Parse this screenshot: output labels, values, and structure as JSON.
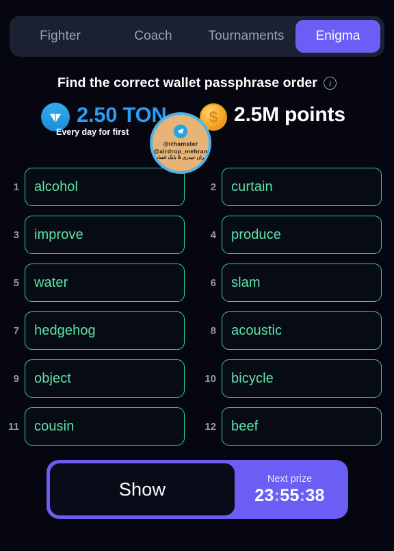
{
  "tabs": [
    {
      "label": "Fighter",
      "active": false
    },
    {
      "label": "Coach",
      "active": false
    },
    {
      "label": "Tournaments",
      "active": false
    },
    {
      "label": "Enigma",
      "active": true
    }
  ],
  "header": {
    "title": "Find the correct wallet passphrase order",
    "info_icon": "info-icon",
    "info_glyph": "i"
  },
  "rewards": {
    "ton": {
      "amount": "2.50 TON",
      "subtitle": "Every day for first",
      "icon": "ton-logo-icon",
      "color": "#2a9df4"
    },
    "points": {
      "amount": "2.5M points",
      "icon": "gold-coin-icon",
      "glyph": "$",
      "color": "#f7a928"
    }
  },
  "watermark": {
    "icon": "telegram-icon",
    "handle_1": "@irhamster",
    "handle_2": "@airdrop_mehran",
    "handle_3": "مهران حیدری & بابک انصاری"
  },
  "grid": {
    "accent_color": "#36d399",
    "text_color": "#5fe3ad",
    "rows": [
      [
        {
          "num": "1",
          "word": "alcohol"
        },
        {
          "num": "2",
          "word": "curtain"
        }
      ],
      [
        {
          "num": "3",
          "word": "improve"
        },
        {
          "num": "4",
          "word": "produce"
        }
      ],
      [
        {
          "num": "5",
          "word": "water"
        },
        {
          "num": "6",
          "word": "slam"
        }
      ],
      [
        {
          "num": "7",
          "word": "hedgehog"
        },
        {
          "num": "8",
          "word": "acoustic"
        }
      ],
      [
        {
          "num": "9",
          "word": "object"
        },
        {
          "num": "10",
          "word": "bicycle"
        }
      ],
      [
        {
          "num": "11",
          "word": "cousin"
        },
        {
          "num": "12",
          "word": "beef"
        }
      ]
    ]
  },
  "bottom": {
    "show_label": "Show",
    "prize_label": "Next prize",
    "prize_hours": "23",
    "prize_minutes": "55",
    "prize_seconds": "38",
    "accent_color": "#6c5ef5"
  }
}
